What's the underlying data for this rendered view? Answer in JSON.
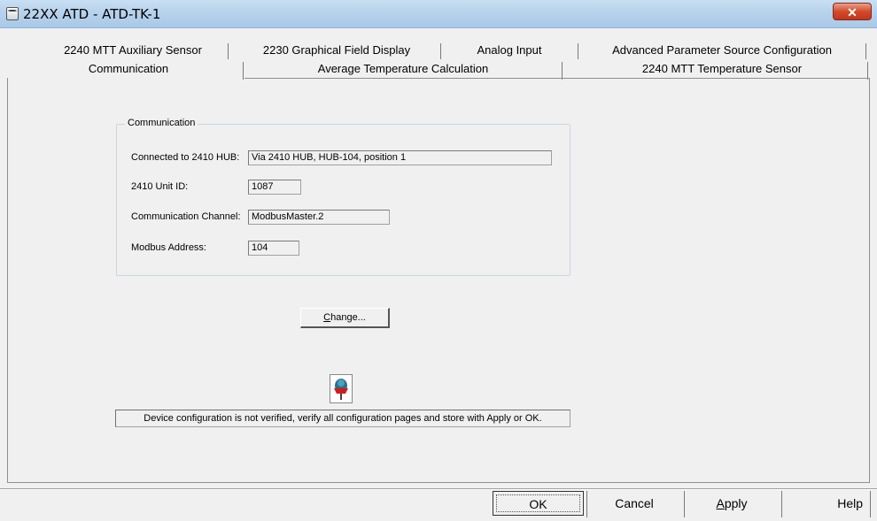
{
  "window": {
    "title": "22XX ATD  - ATD-TK-1",
    "close_glyph": "✕"
  },
  "tabs": {
    "row1": [
      {
        "label": "2240 MTT Auxiliary Sensor"
      },
      {
        "label": "2230 Graphical Field Display"
      },
      {
        "label": "Analog Input"
      },
      {
        "label": "Advanced Parameter Source Configuration"
      }
    ],
    "row2": [
      {
        "label": "Communication",
        "selected": true
      },
      {
        "label": "Average Temperature Calculation"
      },
      {
        "label": "2240 MTT Temperature Sensor"
      }
    ]
  },
  "group": {
    "legend": "Communication",
    "fields": [
      {
        "label": "Connected to 2410 HUB:",
        "value": "Via 2410 HUB,  HUB-104, position 1"
      },
      {
        "label": "2410 Unit ID:",
        "value": "1087"
      },
      {
        "label": "Communication Channel:",
        "value": "ModbusMaster.2"
      },
      {
        "label": "Modbus Address:",
        "value": "104"
      }
    ]
  },
  "change_button": {
    "label_underlined": "C",
    "label_rest": "hange..."
  },
  "status": {
    "icon": "device-status-icon",
    "text": "Device configuration is not verified, verify all configuration pages and store with Apply or OK."
  },
  "footer": {
    "ok": "OK",
    "cancel": "Cancel",
    "apply_underlined": "A",
    "apply_rest": "pply",
    "help": "Help"
  }
}
